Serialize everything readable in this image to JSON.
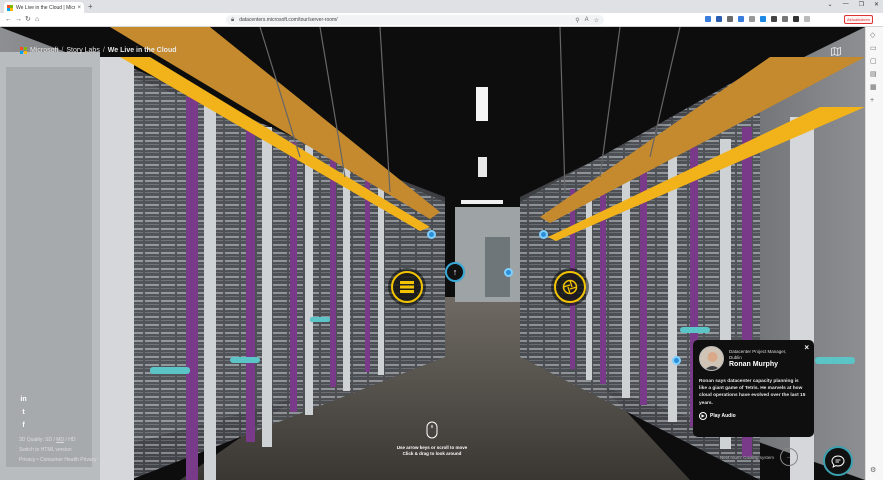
{
  "browser": {
    "tab_title": "We Live in the Cloud | Microso",
    "tab_close": "×",
    "new_tab": "+",
    "window_controls": [
      "⌄",
      "—",
      "❐",
      "✕"
    ],
    "nav": {
      "back": "←",
      "forward": "→",
      "reload": "↻",
      "home": "⌂"
    },
    "url": "datacenters.microsoft.com/tour/server-room/",
    "url_icons": [
      "⚲",
      "A",
      "☆"
    ],
    "wp_badge": "Aktualisieren",
    "menu": "⋯"
  },
  "sidebar_icons": [
    "◇",
    "▭",
    "▢",
    "▤",
    "▦",
    "+",
    "⚙"
  ],
  "brand": {
    "company": "Microsoft",
    "crumbs": [
      "Story Labs",
      "We Live in the Cloud"
    ],
    "separator": "/"
  },
  "footer": {
    "social": [
      "in",
      "t",
      "f"
    ],
    "quality_label": "3D Quality:",
    "quality_options": [
      "SD",
      "MD",
      "HD"
    ],
    "quality_active": "MD",
    "quality_sep": "/",
    "html_link": "Switch to HTML version",
    "legal": [
      "Privacy",
      "Consumer Health Privacy"
    ],
    "legal_sep": "•"
  },
  "hotspots": {
    "arrow_glyph": "↑"
  },
  "hint": {
    "line1": "Use arrow keys or scroll to move",
    "line2": "Click & drag to look around"
  },
  "card": {
    "role_line1": "Datacenter Project Manager,",
    "role_line2": "Dublin",
    "name": "Ronan Murphy",
    "body": "Ronan says datacenter capacity planning is like a giant game of Tetris. He marvels at how cloud operations have evolved over the last 15 years.",
    "audio_label": "Play Audio",
    "close": "×",
    "play_glyph": "▶"
  },
  "next": {
    "label": "Next room: Cooling system",
    "arrow": "→"
  },
  "colors": {
    "accent_yellow": "#f2c300",
    "accent_blue": "#2d8fd8",
    "chat_ring": "#3aa0b0"
  }
}
